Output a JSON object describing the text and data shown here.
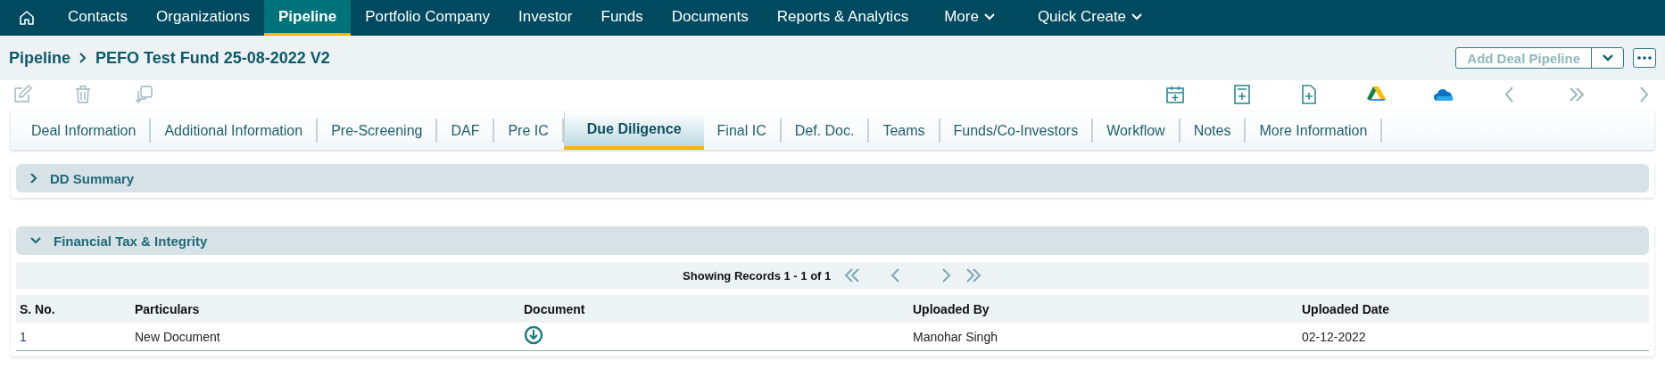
{
  "nav": {
    "items": [
      {
        "label": "Contacts",
        "selected": false,
        "kind": "link"
      },
      {
        "label": "Organizations",
        "selected": false,
        "kind": "link"
      },
      {
        "label": "Pipeline",
        "selected": true,
        "kind": "link"
      },
      {
        "label": "Portfolio Company",
        "selected": false,
        "kind": "link"
      },
      {
        "label": "Investor",
        "selected": false,
        "kind": "link"
      },
      {
        "label": "Funds",
        "selected": false,
        "kind": "link"
      },
      {
        "label": "Documents",
        "selected": false,
        "kind": "link"
      },
      {
        "label": "Reports & Analytics",
        "selected": false,
        "kind": "link"
      },
      {
        "label": "More",
        "selected": false,
        "kind": "menu"
      },
      {
        "label": "Quick Create",
        "selected": false,
        "kind": "menu"
      }
    ]
  },
  "breadcrumb": [
    "Pipeline",
    "PEFO Test Fund 25-08-2022 V2"
  ],
  "add_button": {
    "label": "Add Deal Pipeline",
    "disabled": true
  },
  "tabs": [
    {
      "label": "Deal Information",
      "selected": false
    },
    {
      "label": "Additional Information",
      "selected": false
    },
    {
      "label": "Pre-Screening",
      "selected": false
    },
    {
      "label": "DAF",
      "selected": false
    },
    {
      "label": "Pre IC",
      "selected": false
    },
    {
      "label": "Due Diligence",
      "selected": true
    },
    {
      "label": "Final IC",
      "selected": false
    },
    {
      "label": "Def. Doc.",
      "selected": false
    },
    {
      "label": "Teams",
      "selected": false
    },
    {
      "label": "Funds/Co-Investors",
      "selected": false
    },
    {
      "label": "Workflow",
      "selected": false
    },
    {
      "label": "Notes",
      "selected": false
    },
    {
      "label": "More Information",
      "selected": false
    }
  ],
  "sections": [
    {
      "title": "DD Summary",
      "expanded": false
    },
    {
      "title": "Financial Tax & Integrity",
      "expanded": true,
      "pager": "Showing Records 1 - 1 of 1",
      "table": {
        "columns": [
          "S. No.",
          "Particulars",
          "Document",
          "Uploaded By",
          "Uploaded Date"
        ],
        "rows": [
          {
            "cells": [
              "1",
              "New Document",
              {
                "kind": "download"
              },
              "Manohar Singh",
              "02-12-2022"
            ]
          }
        ]
      }
    }
  ]
}
